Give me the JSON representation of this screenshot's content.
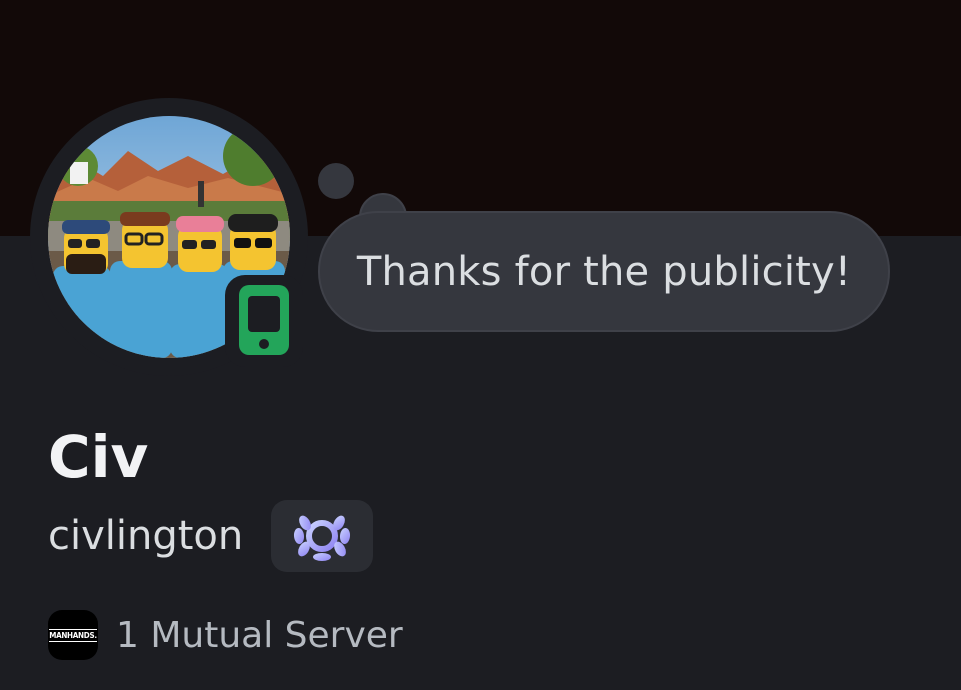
{
  "profile": {
    "display_name": "Civ",
    "username": "civlington",
    "custom_status": "Thanks for the publicity!",
    "online_status": "mobile-online",
    "avatar_icon": "lego-group-photo-avatar",
    "badge_icon": "laurel-wreath-badge-icon"
  },
  "mutual": {
    "server_icon_text": "MANHANDS.",
    "label": "1 Mutual Server"
  },
  "colors": {
    "banner": "#120908",
    "background": "#1c1d22",
    "bubble": "#35373e",
    "status_green": "#23a55a",
    "badge_purple": "#a9b3ff"
  }
}
